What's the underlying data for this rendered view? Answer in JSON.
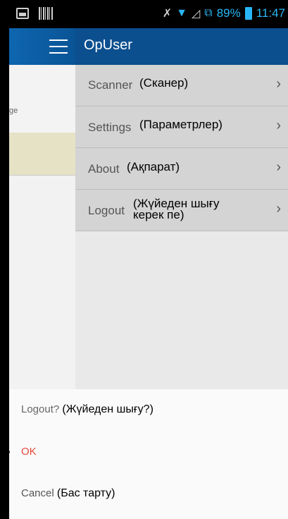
{
  "status_bar": {
    "battery": "89%",
    "time": "11:47"
  },
  "action_bar": {
    "title": "OpUser"
  },
  "content": {
    "fragment": "ge"
  },
  "drawer": {
    "items": [
      {
        "label": "Scanner",
        "note": "(Сканер)"
      },
      {
        "label": "Settings",
        "note": "(Параметрлер)"
      },
      {
        "label": "About",
        "note": "(Ақпарат)"
      },
      {
        "label": "Logout",
        "note_line1": "(Жүйеден шығу",
        "note_line2": "керек пе)"
      }
    ]
  },
  "dialog": {
    "title": "Logout?",
    "title_note": "(Жүйеден шығу?)",
    "ok": "OK",
    "cancel": "Cancel",
    "cancel_note": "(Бас тарту)"
  }
}
